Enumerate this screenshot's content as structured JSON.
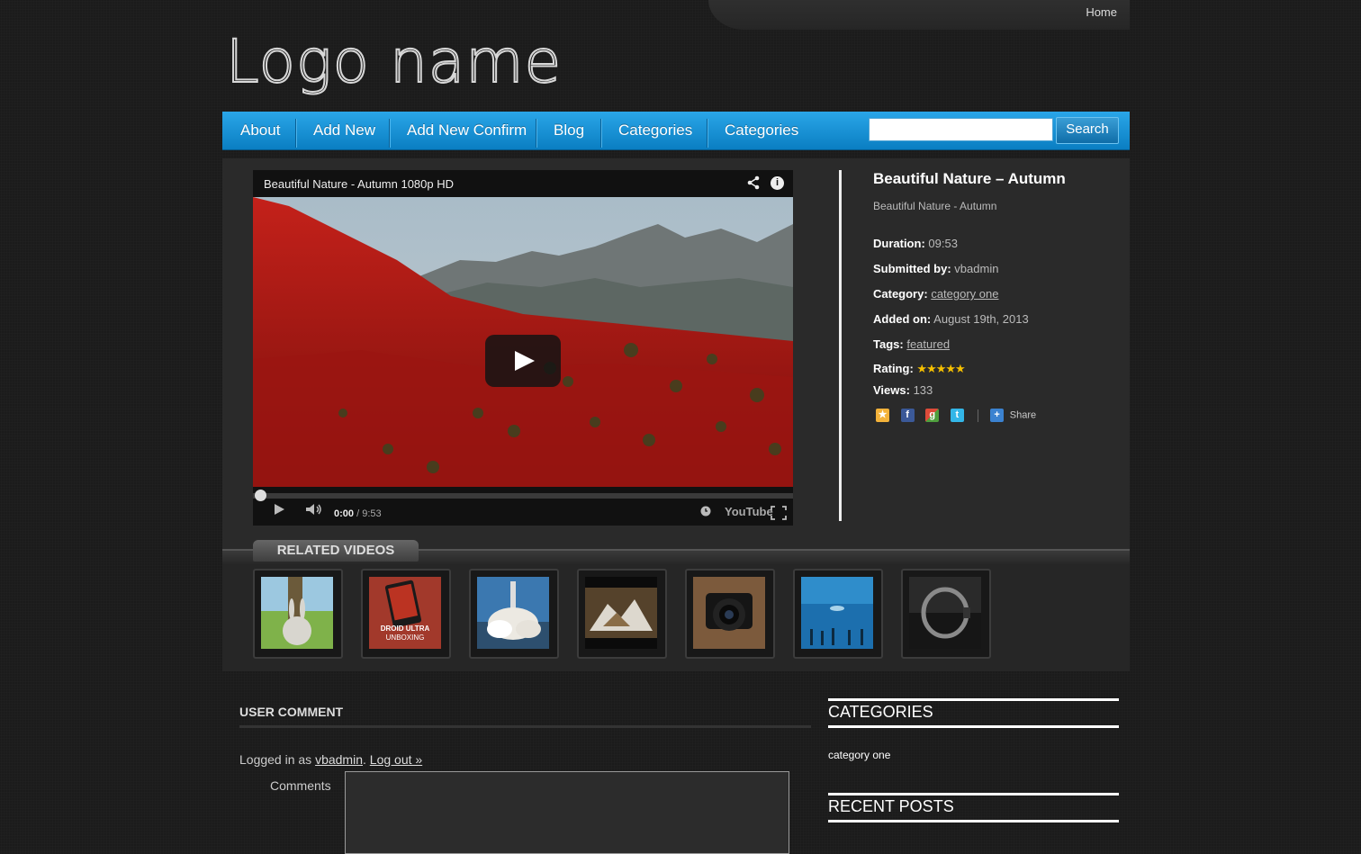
{
  "topbar": {
    "home": "Home"
  },
  "logo": "Logo name",
  "nav": {
    "items": [
      "About",
      "Add New",
      "Add New Confirm",
      "Blog",
      "Categories",
      "Categories"
    ],
    "search_button": "Search",
    "accent": "#1a92d6"
  },
  "player": {
    "title": "Beautiful Nature - Autumn 1080p HD",
    "current_time": "0:00",
    "duration": "/ 9:53",
    "brand": "YouTube"
  },
  "video": {
    "title": "Beautiful Nature – Autumn",
    "subtitle": "Beautiful Nature - Autumn",
    "duration_label": "Duration:",
    "duration": "09:53",
    "submitted_label": "Submitted by:",
    "submitted": "vbadmin",
    "category_label": "Category:",
    "category": "category one",
    "added_label": "Added on:",
    "added": "August 19th, 2013",
    "tags_label": "Tags:",
    "tags": "featured",
    "rating_label": "Rating:",
    "rating": 5,
    "rating_max": 5,
    "views_label": "Views:",
    "views": "133",
    "share": "Share"
  },
  "related": {
    "heading": "RELATED VIDEOS",
    "thumbs": [
      {
        "icon": "rabbit-thumbnail"
      },
      {
        "icon": "phone-unboxing-thumbnail",
        "caption1": "DROID ULTRA",
        "caption2": "UNBOXING"
      },
      {
        "icon": "rocket-launch-thumbnail"
      },
      {
        "icon": "snow-scene-thumbnail"
      },
      {
        "icon": "camera-thumbnail"
      },
      {
        "icon": "aquarium-thumbnail"
      },
      {
        "icon": "wristband-thumbnail"
      }
    ]
  },
  "comments": {
    "heading": "USER COMMENT",
    "logged_prefix": "Logged in as",
    "user": "vbadmin",
    "sep": ".",
    "logout": "Log out »",
    "label": "Comments"
  },
  "sidebar": {
    "categories_heading": "CATEGORIES",
    "category_item": "category one",
    "recent_heading": "RECENT POSTS"
  }
}
